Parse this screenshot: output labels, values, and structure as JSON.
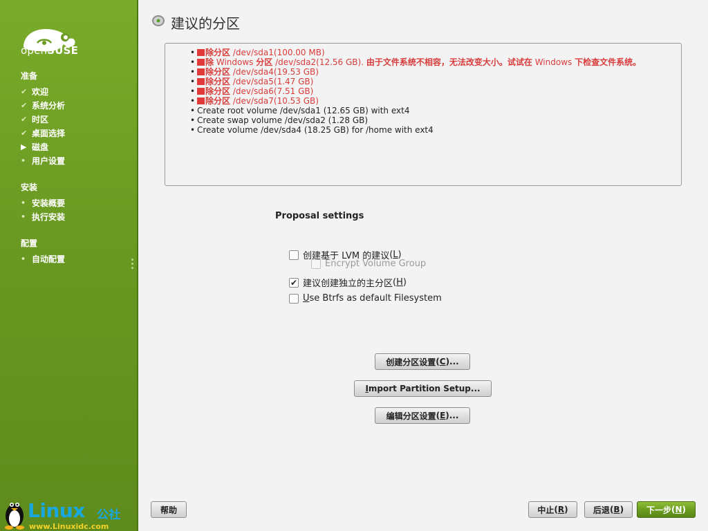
{
  "brand": {
    "logo_text_light": "open",
    "logo_text_bold": "SUSE"
  },
  "sidebar": {
    "sections": [
      {
        "title": "准备",
        "steps": [
          {
            "label": "欢迎",
            "state": "done"
          },
          {
            "label": "系统分析",
            "state": "done"
          },
          {
            "label": "时区",
            "state": "done"
          },
          {
            "label": "桌面选择",
            "state": "done"
          },
          {
            "label": "磁盘",
            "state": "current"
          },
          {
            "label": "用户设置",
            "state": "pending"
          }
        ]
      },
      {
        "title": "安装",
        "steps": [
          {
            "label": "安装概要",
            "state": "pending"
          },
          {
            "label": "执行安装",
            "state": "pending"
          }
        ]
      },
      {
        "title": "配置",
        "steps": [
          {
            "label": "自动配置",
            "state": "pending"
          }
        ]
      }
    ]
  },
  "watermark": {
    "name": "Linux",
    "cn": "公社",
    "url": "www.Linuxidc.com"
  },
  "page": {
    "title": "建议的分区"
  },
  "summary": {
    "delete_label": "除分区",
    "delete_items": [
      {
        "device": "/dev/sda1(100.00 MB)"
      },
      {
        "device": "/dev/sda4(19.53 GB)"
      },
      {
        "device": "/dev/sda5(1.47 GB)"
      },
      {
        "device": "/dev/sda6(7.51 GB)"
      },
      {
        "device": "/dev/sda7(10.53 GB)"
      }
    ],
    "windows_line": {
      "prefix": "除",
      "windows": "Windows",
      "part_word": "分区",
      "device": "/dev/sda2(12.56 GB).",
      "warn1": "由于文件系统不相容，无法改变大小。试试在",
      "windows2": "Windows",
      "warn2": "下检查文件系统。"
    },
    "create_items": [
      "Create root volume /dev/sda1 (12.65 GB) with ext4",
      "Create swap volume /dev/sda2 (1.28 GB)",
      "Create volume /dev/sda4 (18.25 GB) for /home with ext4"
    ]
  },
  "proposal": {
    "heading": "Proposal settings",
    "lvm": {
      "label": "创建基于 LVM 的建议",
      "key": "L",
      "checked": false
    },
    "encrypt": {
      "label": "Encrypt Volume Group",
      "checked": false,
      "disabled": true
    },
    "separate_home": {
      "label": "建议创建独立的主分区",
      "key": "H",
      "checked": true
    },
    "btrfs": {
      "label_key": "U",
      "label_rest": "se Btrfs as default Filesystem",
      "checked": false
    }
  },
  "buttons": {
    "create_setup": {
      "label": "创建分区设置",
      "key": "C",
      "suffix": "..."
    },
    "import_setup": {
      "key": "I",
      "label_rest": "mport Partition Setup..."
    },
    "edit_setup": {
      "label": "编辑分区设置",
      "key": "E",
      "suffix": "..."
    },
    "help": "帮助",
    "abort": {
      "label": "中止",
      "key": "R"
    },
    "back": {
      "label": "后退",
      "key": "B"
    },
    "next": {
      "label": "下一步",
      "key": "N"
    }
  },
  "colors": {
    "sidebar": "#6b9b22",
    "accent_red": "#d93b3b",
    "primary_button": "#6d9d1f"
  }
}
